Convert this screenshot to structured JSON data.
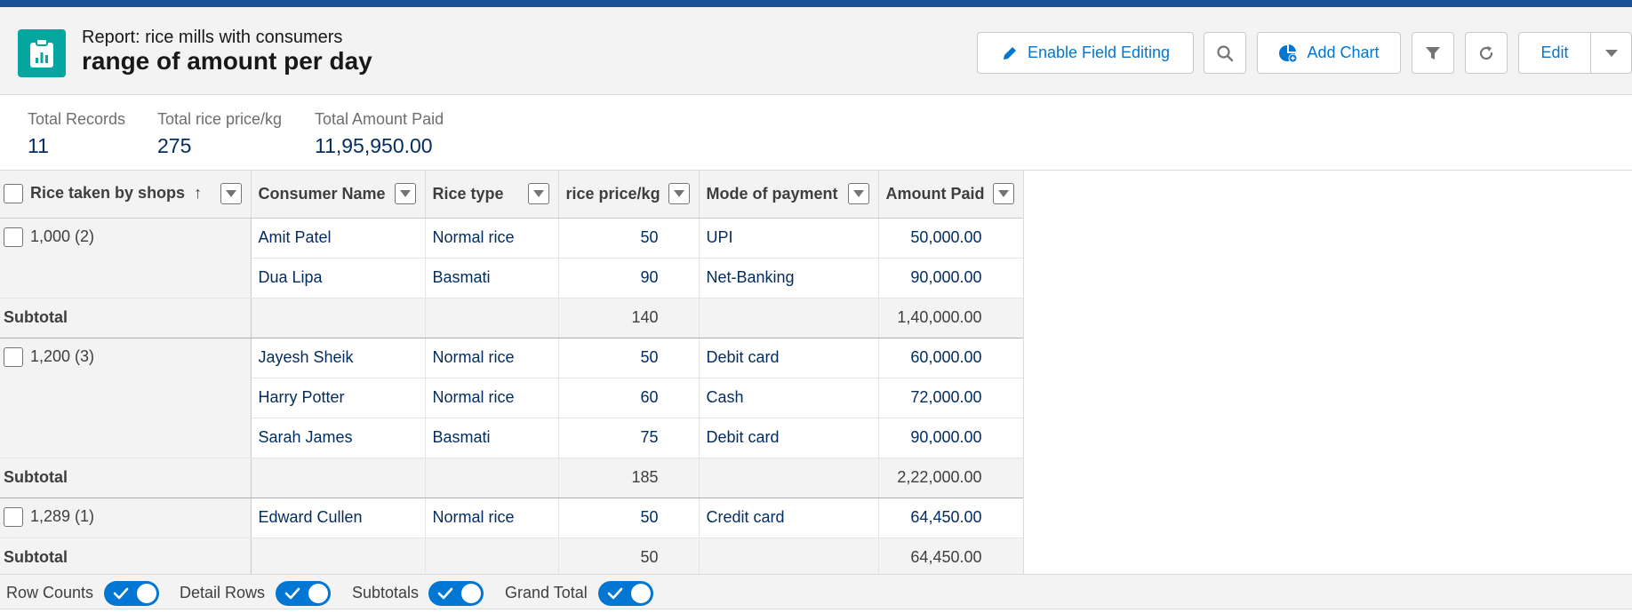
{
  "header": {
    "subtitle": "Report: rice mills with consumers",
    "title": "range of amount per day",
    "buttons": {
      "enable_field_editing": "Enable Field Editing",
      "add_chart": "Add Chart",
      "edit": "Edit"
    }
  },
  "summary": [
    {
      "label": "Total Records",
      "value": "11"
    },
    {
      "label": "Total rice price/kg",
      "value": "275"
    },
    {
      "label": "Total Amount Paid",
      "value": "11,95,950.00"
    }
  ],
  "table": {
    "columns": [
      "Rice taken by shops",
      "Consumer Name",
      "Rice type",
      "rice price/kg",
      "Mode of payment",
      "Amount Paid"
    ],
    "sort_indicator": "↑",
    "groups": [
      {
        "label": "1,000 (2)",
        "rows": [
          {
            "consumer": "Amit Patel",
            "type": "Normal rice",
            "price": "50",
            "mode": "UPI",
            "amount": "50,000.00"
          },
          {
            "consumer": "Dua Lipa",
            "type": "Basmati",
            "price": "90",
            "mode": "Net-Banking",
            "amount": "90,000.00"
          }
        ],
        "subtotal_label": "Subtotal",
        "subtotal_price": "140",
        "subtotal_amount": "1,40,000.00"
      },
      {
        "label": "1,200 (3)",
        "rows": [
          {
            "consumer": "Jayesh Sheik",
            "type": "Normal rice",
            "price": "50",
            "mode": "Debit card",
            "amount": "60,000.00"
          },
          {
            "consumer": "Harry Potter",
            "type": "Normal rice",
            "price": "60",
            "mode": "Cash",
            "amount": "72,000.00"
          },
          {
            "consumer": "Sarah James",
            "type": "Basmati",
            "price": "75",
            "mode": "Debit card",
            "amount": "90,000.00"
          }
        ],
        "subtotal_label": "Subtotal",
        "subtotal_price": "185",
        "subtotal_amount": "2,22,000.00"
      },
      {
        "label": "1,289 (1)",
        "rows": [
          {
            "consumer": "Edward Cullen",
            "type": "Normal rice",
            "price": "50",
            "mode": "Credit card",
            "amount": "64,450.00"
          }
        ],
        "subtotal_label": "Subtotal",
        "subtotal_price": "50",
        "subtotal_amount": "64,450.00"
      }
    ]
  },
  "footer": {
    "toggles": [
      "Row Counts",
      "Detail Rows",
      "Subtotals",
      "Grand Total"
    ]
  },
  "colors": {
    "accent": "#0176d3",
    "brand_band": "#1b5297",
    "app_icon": "#05a6a0"
  }
}
